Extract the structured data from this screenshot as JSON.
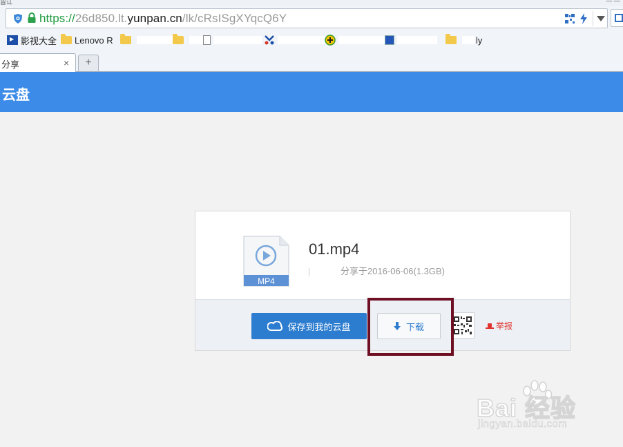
{
  "browser": {
    "top_strip_left": "皆讧",
    "top_strip_right": "— —",
    "url": {
      "scheme": "https://",
      "sub": "26d850.lt.",
      "domain": "yunpan.cn",
      "path": "/lk/cRsISgXYqcQ6Y"
    },
    "bookmarks": [
      {
        "label": "影视大全",
        "icon": "film-icon"
      },
      {
        "label": "Lenovo R",
        "icon": "folder-icon"
      },
      {
        "label": "",
        "icon": "folder-icon"
      },
      {
        "label": "",
        "icon": "folder-icon"
      },
      {
        "label": "",
        "icon": "page-icon"
      },
      {
        "label": "",
        "icon": "scissors-icon"
      },
      {
        "label": "",
        "icon": "plus-badge-icon"
      },
      {
        "label": "",
        "icon": "image-icon"
      },
      {
        "label": "ly",
        "icon": "folder-icon"
      }
    ],
    "tab": {
      "label": "分享",
      "close": "×"
    },
    "new_tab_label": "+"
  },
  "header": {
    "title": "云盘"
  },
  "file": {
    "name": "01.mp4",
    "type_label": "MP4",
    "meta": "分享于2016-06-06(1.3GB)"
  },
  "actions": {
    "save_label": "保存到我的云盘",
    "download_label": "下载",
    "report_label": "举报"
  },
  "watermark": {
    "text": "Bai  经验",
    "url": "jingyan.baidu.com"
  },
  "colors": {
    "header": "#3d8be8",
    "save_button": "#2c7ccf",
    "highlight": "#6e0f24",
    "report": "#e0322f",
    "url_scheme": "#1d9a3d"
  }
}
